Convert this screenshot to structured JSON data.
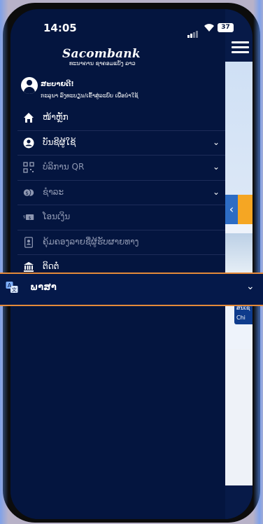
{
  "status_bar": {
    "time": "14:05",
    "battery": "37"
  },
  "logo": {
    "brand": "Sacombank",
    "subtitle": "ທະນາຄານ ຊາຄອມແບັງ ລາວ"
  },
  "user": {
    "greeting": "ສະບາຍດີ!",
    "subtitle": "ກະລຸນາ ລົງທະບຽນ/ເຂົ້າສູ່ລະບົບ ເພື່ອນຳໃຊ້"
  },
  "menu": [
    {
      "label": "ໜ້າຫຼັກ",
      "icon": "home-icon",
      "expandable": false,
      "enabled": true
    },
    {
      "label": "ບັນຊີຜູ້ໃຊ້",
      "icon": "user-circle-icon",
      "expandable": true,
      "enabled": true
    },
    {
      "label": "ບໍລິການ QR",
      "icon": "qr-code-icon",
      "expandable": true,
      "enabled": false
    },
    {
      "label": "ຊຳລະ",
      "icon": "payment-icon",
      "expandable": true,
      "enabled": false
    },
    {
      "label": "ໂອນເງິນ",
      "icon": "transfer-icon",
      "expandable": false,
      "enabled": false
    },
    {
      "label": "ຄຸ້ມຄອງລາຍຊື່ຜູ້ຮັບຜາຍທາງ",
      "icon": "contacts-icon",
      "expandable": false,
      "enabled": false
    },
    {
      "label": "ຕິດຕໍ່",
      "icon": "bank-icon",
      "expandable": false,
      "enabled": true
    }
  ],
  "language": {
    "label": "ພາສາ",
    "icon": "translate-icon"
  },
  "background_chip": {
    "line1": "ສິນເຊື່",
    "line2": "Chi"
  },
  "colors": {
    "drawer_bg": "#04153f",
    "accent_orange": "#e58a3a",
    "panel_blue": "#2d6cc4"
  }
}
